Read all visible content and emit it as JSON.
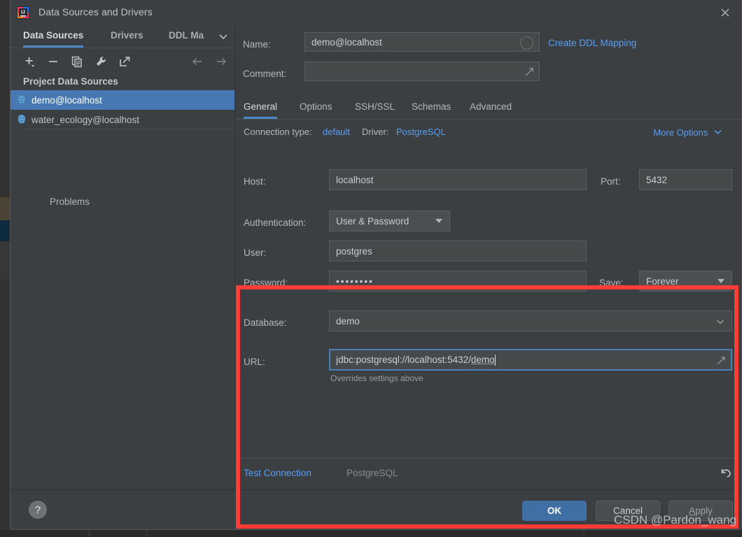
{
  "window": {
    "title": "Data Sources and Drivers",
    "app_icon": "intellij-idea-logo",
    "close_icon": "close-icon"
  },
  "left_panel": {
    "tabs": [
      {
        "label": "Data Sources",
        "active": true
      },
      {
        "label": "Drivers",
        "active": false
      },
      {
        "label": "DDL Ma",
        "active": false
      }
    ],
    "overflow_icon": "chevron-down-icon",
    "toolbar": [
      {
        "name": "add",
        "icon": "plus-icon"
      },
      {
        "name": "remove",
        "icon": "minus-icon"
      },
      {
        "name": "copy",
        "icon": "copy-icon"
      },
      {
        "name": "properties",
        "icon": "wrench-icon"
      },
      {
        "name": "export",
        "icon": "share-arrow-icon"
      },
      {
        "name": "back",
        "icon": "arrow-left-icon"
      },
      {
        "name": "forward",
        "icon": "arrow-right-icon"
      }
    ],
    "section_label": "Project Data Sources",
    "data_sources": [
      {
        "label": "demo@localhost",
        "icon": "postgresql-icon",
        "selected": true
      },
      {
        "label": "water_ecology@localhost",
        "icon": "postgresql-icon",
        "selected": false
      }
    ],
    "problems_label": "Problems"
  },
  "header": {
    "name_label": "Name:",
    "name_value": "demo@localhost",
    "name_color_icon": "color-circle-icon",
    "create_ddl_mapping": "Create DDL Mapping",
    "comment_label": "Comment:",
    "comment_value": "",
    "comment_expand_icon": "expand-icon"
  },
  "subtabs": [
    {
      "label": "General",
      "active": true
    },
    {
      "label": "Options",
      "active": false
    },
    {
      "label": "SSH/SSL",
      "active": false
    },
    {
      "label": "Schemas",
      "active": false
    },
    {
      "label": "Advanced",
      "active": false
    }
  ],
  "meta": {
    "connection_type_label": "Connection type:",
    "connection_type_value": "default",
    "driver_label": "Driver:",
    "driver_value": "PostgreSQL",
    "more_options": "More Options",
    "more_options_icon": "chevron-down-icon"
  },
  "connection": {
    "host_label": "Host:",
    "host_value": "localhost",
    "port_label": "Port:",
    "port_value": "5432",
    "auth_label": "Authentication:",
    "auth_value": "User & Password",
    "auth_dropdown_icon": "triangle-down-icon",
    "user_label": "User:",
    "user_value": "postgres",
    "password_label": "Password:",
    "password_value": "••••••••",
    "save_label": "Save:",
    "save_value": "Forever",
    "save_dropdown_icon": "triangle-down-icon",
    "database_label": "Database:",
    "database_value": "demo",
    "database_dropdown_icon": "chevron-down-icon",
    "url_label": "URL:",
    "url_value_prefix": "jdbc:postgresql://localhost:5432/",
    "url_value_highlight": "demo",
    "url_expand_icon": "expand-icon",
    "url_hint": "Overrides settings above"
  },
  "bottom_strip": {
    "test_connection": "Test Connection",
    "driver_status": "PostgreSQL",
    "revert_icon": "revert-arrow-icon"
  },
  "footer": {
    "help_label": "?",
    "ok_label": "OK",
    "cancel_label": "Cancel",
    "apply_label_accel": "A",
    "apply_label_rest": "pply"
  },
  "watermark": "CSDN @Pardon_wang",
  "colors": {
    "accent_blue": "#4a88c7",
    "link_blue": "#589df6",
    "selection_blue": "#4878b4",
    "ok_button_blue": "#3f6fa5",
    "highlight_red": "#ff3c35",
    "panel_bg": "#3c3f41",
    "field_bg": "#45494a"
  }
}
